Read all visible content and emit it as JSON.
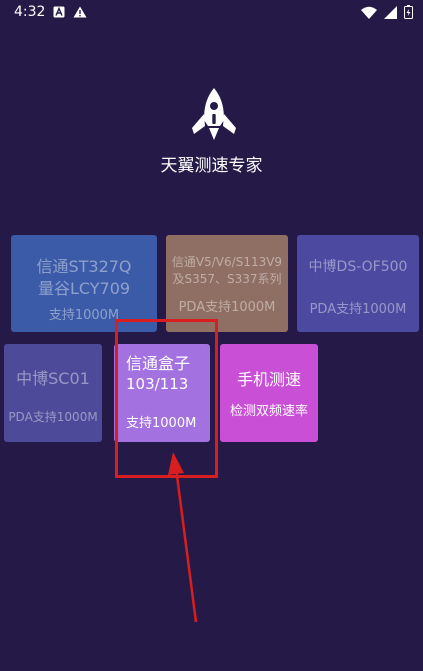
{
  "status_bar": {
    "time": "4:32",
    "left_icons": [
      "notification-a-icon",
      "warning-icon"
    ],
    "right_icons": [
      "wifi-icon",
      "signal-icon",
      "battery-icon"
    ]
  },
  "app": {
    "logo_icon": "rocket-icon",
    "title": "天翼测速专家"
  },
  "devices": [
    {
      "line1": "信通ST327Q",
      "line2": "量谷LCY709",
      "sub": "支持1000M",
      "state": "disabled"
    },
    {
      "line1": "信通V5/V6/S113V9",
      "line2": "及S357、S337系列",
      "sub": "PDA支持1000M",
      "state": "disabled"
    },
    {
      "line1": "中博DS-OF500",
      "sub": "PDA支持1000M",
      "state": "disabled"
    },
    {
      "line1": "中博SC01",
      "sub": "PDA支持1000M",
      "state": "disabled"
    },
    {
      "line1": "信通盒子",
      "line2": "103/113",
      "sub": "支持1000M",
      "state": "active",
      "highlighted": true
    },
    {
      "line1": "手机测速",
      "sub": "检测双频速率",
      "state": "active"
    }
  ],
  "colors": {
    "background": "#251a47",
    "highlight": "#d81e1e",
    "card_xintong_box": "#a471e0",
    "card_phone": "#c94fd6"
  }
}
